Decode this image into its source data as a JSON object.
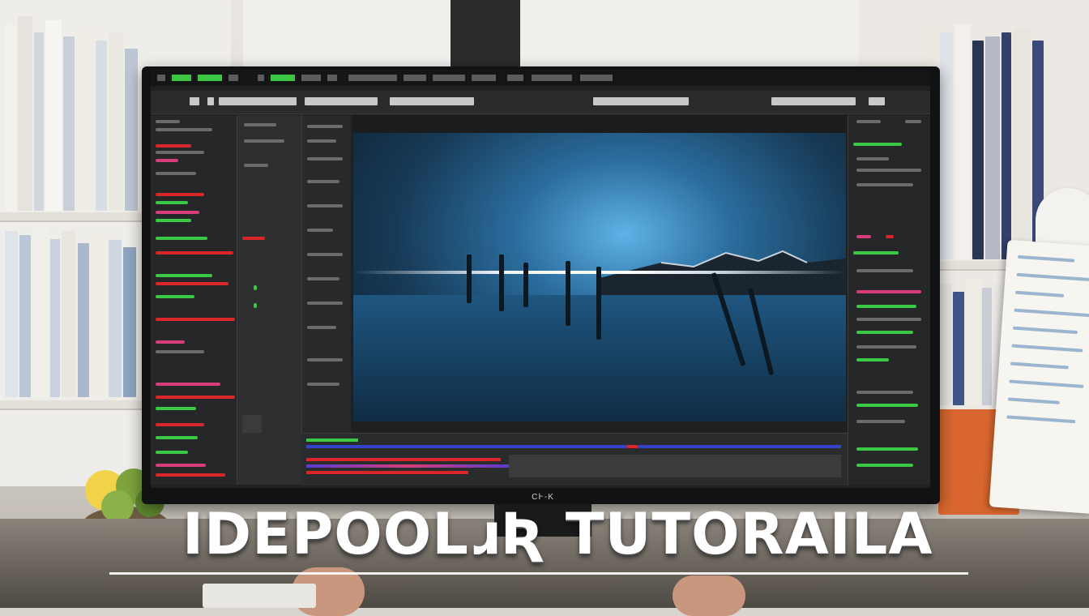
{
  "overlay": {
    "title": "IDEPOOLɹƦ TUTORAILA"
  },
  "monitor": {
    "brand_mark": "CͰ-K"
  },
  "colors": {
    "accent_red": "#d8262b",
    "accent_green": "#3bc842",
    "accent_pink": "#d63c7a",
    "viewer_blue": "#2b6d9e"
  },
  "icons": [
    "menu-icons",
    "toolbar-fields"
  ]
}
